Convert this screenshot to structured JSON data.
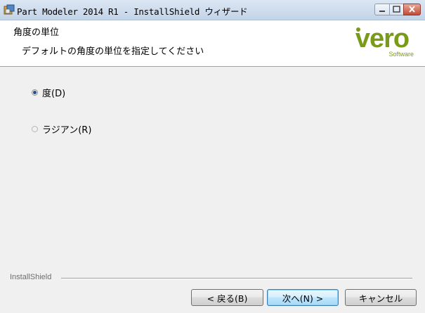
{
  "window": {
    "title": "Part Modeler 2014 R1 - InstallShield ウィザード"
  },
  "header": {
    "title": "角度の単位",
    "subtitle": "デフォルトの角度の単位を指定してください",
    "logo_text": "vero",
    "logo_subtext": "Software",
    "logo_color": "#7a9a1a"
  },
  "options": [
    {
      "label": "度(D)",
      "selected": true
    },
    {
      "label": "ラジアン(R)",
      "selected": false
    }
  ],
  "footer": {
    "brand": "InstallShield",
    "back_label": "< 戻る(B)",
    "next_label": "次へ(N) >",
    "cancel_label": "キャンセル"
  }
}
